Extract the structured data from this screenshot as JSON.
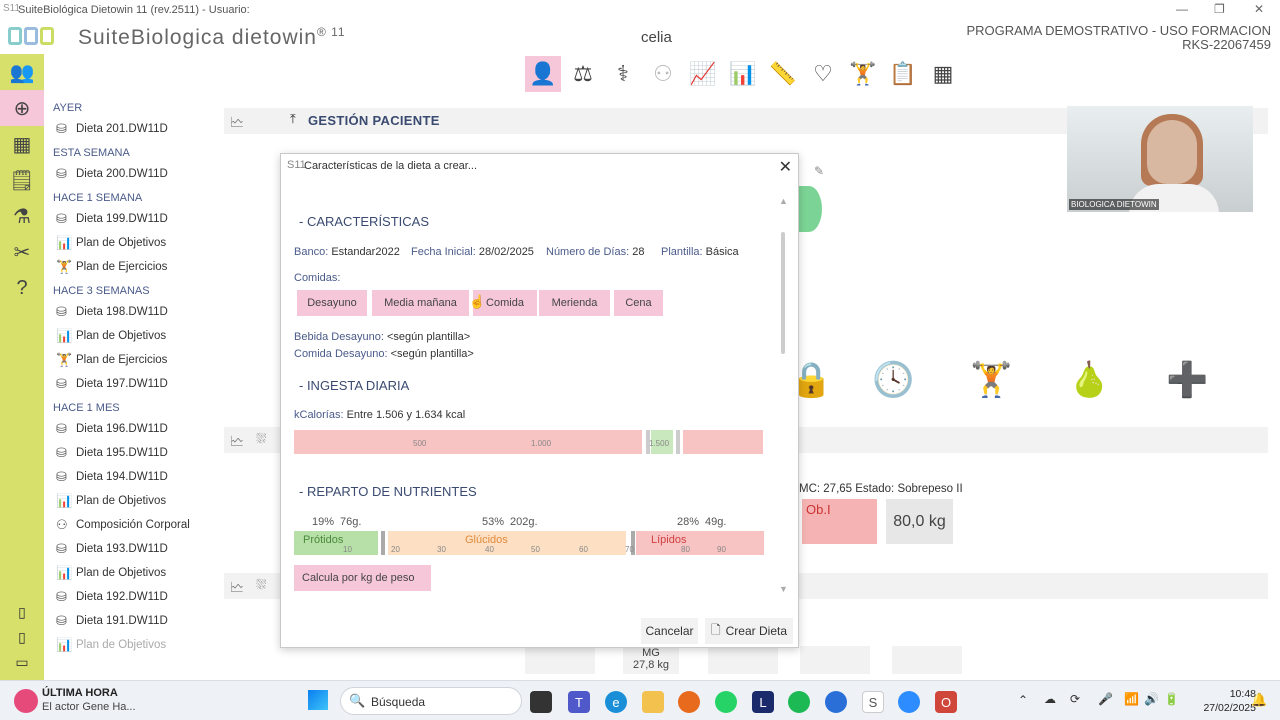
{
  "window": {
    "title": "SuiteBiológica Dietowin 11  (rev.2511) - Usuario:",
    "logo": "S11",
    "minimize": "—",
    "restore": "❐",
    "close": "✕"
  },
  "header": {
    "brand": "SuiteBiologica dietowin",
    "brand_version": "® 11",
    "user": "celia",
    "program_line1": "PROGRAMA DEMOSTRATIVO  - USO FORMACION",
    "program_line2": "RKS-22067459"
  },
  "toolbar": [
    {
      "icon": "user-icon",
      "glyph": "👤"
    },
    {
      "icon": "scale-icon",
      "glyph": "⚖"
    },
    {
      "icon": "measure-icon",
      "glyph": "⚕"
    },
    {
      "icon": "people-icon",
      "glyph": "⚇"
    },
    {
      "icon": "chart-icon",
      "glyph": "📈"
    },
    {
      "icon": "bars-icon",
      "glyph": "📊"
    },
    {
      "icon": "ruler-icon",
      "glyph": "📏"
    },
    {
      "icon": "heart-icon",
      "glyph": "♡"
    },
    {
      "icon": "weights-icon",
      "glyph": "🏋"
    },
    {
      "icon": "clipboard-icon",
      "glyph": "📋"
    },
    {
      "icon": "table-icon",
      "glyph": "▦"
    }
  ],
  "leftbar": [
    {
      "icon": "patients-icon",
      "glyph": "👥"
    },
    {
      "icon": "new-icon",
      "glyph": "⊕"
    },
    {
      "icon": "calculator-icon",
      "glyph": "▦"
    },
    {
      "icon": "document-icon",
      "glyph": "🗒"
    },
    {
      "icon": "flask-icon",
      "glyph": "⚗"
    },
    {
      "icon": "tools-icon",
      "glyph": "✂"
    },
    {
      "icon": "help-icon",
      "glyph": "?"
    }
  ],
  "recent": {
    "groups": [
      {
        "label": "AYER",
        "items": [
          {
            "icon": "⛁",
            "text": "Dieta 201.DW11D"
          }
        ]
      },
      {
        "label": "ESTA SEMANA",
        "items": [
          {
            "icon": "⛁",
            "text": "Dieta 200.DW11D"
          }
        ]
      },
      {
        "label": "HACE 1 SEMANA",
        "items": [
          {
            "icon": "⛁",
            "text": "Dieta 199.DW11D"
          },
          {
            "icon": "📊",
            "text": "Plan de Objetivos"
          },
          {
            "icon": "🏋",
            "text": "Plan de Ejercicios"
          }
        ]
      },
      {
        "label": "HACE 3 SEMANAS",
        "items": [
          {
            "icon": "⛁",
            "text": "Dieta 198.DW11D"
          },
          {
            "icon": "📊",
            "text": "Plan de Objetivos"
          },
          {
            "icon": "🏋",
            "text": "Plan de Ejercicios"
          },
          {
            "icon": "⛁",
            "text": "Dieta 197.DW11D"
          }
        ]
      },
      {
        "label": "HACE 1 MES",
        "items": [
          {
            "icon": "⛁",
            "text": "Dieta 196.DW11D"
          },
          {
            "icon": "⛁",
            "text": "Dieta 195.DW11D"
          },
          {
            "icon": "⛁",
            "text": "Dieta 194.DW11D"
          },
          {
            "icon": "📊",
            "text": "Plan de Objetivos"
          },
          {
            "icon": "⚇",
            "text": "Composición Corporal"
          },
          {
            "icon": "⛁",
            "text": "Dieta 193.DW11D"
          },
          {
            "icon": "📊",
            "text": "Plan de Objetivos"
          },
          {
            "icon": "⛁",
            "text": "Dieta 192.DW11D"
          },
          {
            "icon": "⛁",
            "text": "Dieta 191.DW11D"
          },
          {
            "icon": "📊",
            "text": "Plan de Objetivos"
          }
        ]
      }
    ]
  },
  "main": {
    "section_title": "GESTIÓN PACIENTE",
    "imc": "MC: 27,65  Estado: Sobrepeso II",
    "ob": "Ob.I",
    "weight": "80,0 kg",
    "mg_label": "MG",
    "mg_value": "27,8 kg"
  },
  "video": {
    "label": "BIOLOGICA DIETOWIN"
  },
  "dialog": {
    "title": "Características de la dieta a crear...",
    "logo": "S11",
    "sec1": "- CARACTERÍSTICAS",
    "banco_l": "Banco:",
    "banco_v": "Estandar2022",
    "fecha_l": "Fecha Inicial:",
    "fecha_v": "28/02/2025",
    "dias_l": "Número de Días:",
    "dias_v": "28",
    "plantilla_l": "Plantilla:",
    "plantilla_v": "Básica",
    "comidas_l": "Comidas:",
    "meals": [
      "Desayuno",
      "Media mañana",
      "Comida",
      "Merienda",
      "Cena"
    ],
    "bebida_l": "Bebida Desayuno:",
    "bebida_v": "<según plantilla>",
    "comida_l": "Comida Desayuno:",
    "comida_v": "<según plantilla>",
    "sec2": "- INGESTA DIARIA",
    "kcal_l": "kCalorías:",
    "kcal_v": "Entre 1.506 y 1.634 kcal",
    "kcal_ticks": [
      "500",
      "1.000",
      "1.500"
    ],
    "kcal_min": 1506,
    "kcal_max": 1634,
    "sec3": "- REPARTO DE NUTRIENTES",
    "nutrients": [
      {
        "name": "Prótidos",
        "pct": "19%",
        "g": "76g.",
        "color": "#b7dfa8",
        "text": "#4a8a3a"
      },
      {
        "name": "Glúcidos",
        "pct": "53%",
        "g": "202g.",
        "color": "#fde0c4",
        "text": "#e08a3a"
      },
      {
        "name": "Lípidos",
        "pct": "28%",
        "g": "49g.",
        "color": "#f8c3c3",
        "text": "#d04040"
      }
    ],
    "n_ticks": [
      "10",
      "20",
      "30",
      "40",
      "50",
      "60",
      "70",
      "80",
      "90"
    ],
    "calc_btn": "Calcula por kg de peso",
    "cancel": "Cancelar",
    "create": "Crear Dieta"
  },
  "taskbar": {
    "news_title": "ÚLTIMA HORA",
    "news_text": "El actor Gene Ha...",
    "search": "Búsqueda",
    "time": "10:48",
    "date": "27/02/2025"
  }
}
